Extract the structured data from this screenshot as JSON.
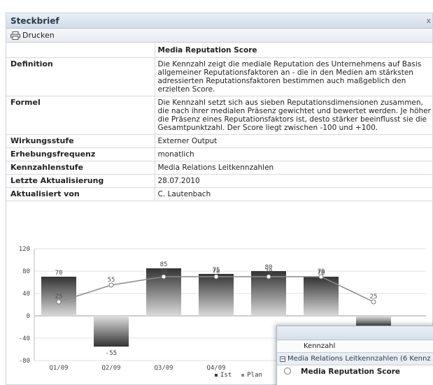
{
  "window": {
    "title": "Steckbrief",
    "close_glyph": "x"
  },
  "toolbar": {
    "print_label": "Drucken",
    "print_icon": "printer-icon"
  },
  "kpi": {
    "title": "Media Reputation Score",
    "rows": [
      {
        "label": "Definition",
        "value": "Die Kennzahl zeigt die mediale Reputation des Unternehmens auf Basis allgemeiner Reputationsfaktoren an - die in den Medien am stärksten adressierten Reputationsfaktoren bestimmen auch maßgeblich den erzielten Score."
      },
      {
        "label": "Formel",
        "value": "Die Kennzahl setzt sich aus sieben Reputationsdimensionen zusammen, die nach ihrer medialen Präsenz gewichtet und bewertet werden. Je höher die Präsenz eines Reputationsfaktors ist, desto stärker beeinflusst sie die Gesamtpunktzahl. Der Score liegt zwischen -100 und +100."
      },
      {
        "label": "Wirkungsstufe",
        "value": "Externer Output"
      },
      {
        "label": "Erhebungsfrequenz",
        "value": "monatlich"
      },
      {
        "label": "Kennzahlenstufe",
        "value": "Media Relations Leitkennzahlen"
      },
      {
        "label": "Letzte Aktualisierung",
        "value": "28.07.2010"
      },
      {
        "label": "Aktualisiert von",
        "value": "C. Lautenbach"
      }
    ]
  },
  "chart_data": {
    "type": "bar",
    "categories": [
      "Q1/09",
      "Q2/09",
      "Q3/09",
      "Q4/09",
      "",
      "",
      ""
    ],
    "ylim": [
      -80,
      120
    ],
    "yticks": [
      120,
      80,
      40,
      0,
      -40,
      -80
    ],
    "grid": true,
    "series": [
      {
        "name": "Ist",
        "type": "bar",
        "values": [
          70,
          -55,
          85,
          75,
          80,
          70,
          -20
        ],
        "color": "#404040"
      },
      {
        "name": "Plan",
        "type": "line",
        "values": [
          25,
          55,
          70,
          70,
          70,
          70,
          25
        ],
        "color": "#8a8a8a"
      }
    ],
    "bar_labels": [
      "70",
      "-55",
      "85",
      "75",
      "80",
      "70",
      "-20"
    ],
    "line_labels": [
      "25",
      "55",
      "70",
      "78",
      "70",
      "79",
      "25"
    ],
    "legend": {
      "placement": "bottom",
      "items": [
        "Ist",
        "Plan"
      ]
    }
  },
  "popup": {
    "column_header": "Kennzahl",
    "group_label": "Media Relations Leitkennzahlen (6 Kennz",
    "row_label": "Media Reputation Score"
  }
}
